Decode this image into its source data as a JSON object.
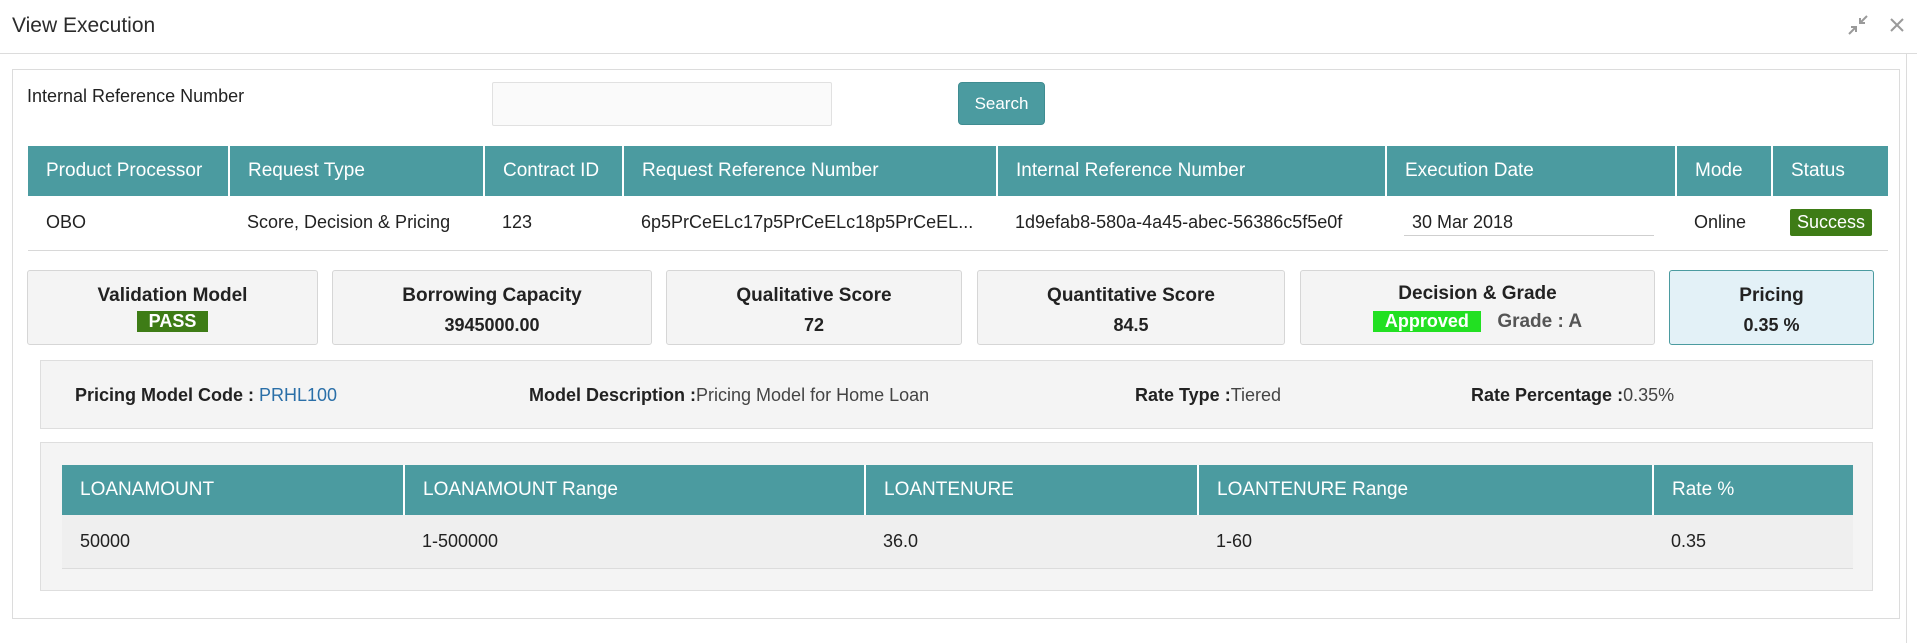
{
  "window": {
    "title": "View Execution",
    "minimize_icon": "collapse-arrows-icon",
    "close_icon": "close-icon"
  },
  "search": {
    "label": "Internal Reference Number",
    "value": "",
    "placeholder": "",
    "button_label": "Search"
  },
  "execution_table": {
    "headers": [
      "Product Processor",
      "Request Type",
      "Contract ID",
      "Request Reference Number",
      "Internal Reference Number",
      "Execution Date",
      "Mode",
      "Status"
    ],
    "row": {
      "product_processor": "OBO",
      "request_type": "Score, Decision & Pricing",
      "contract_id": "123",
      "request_reference_number": "6p5PrCeELc17p5PrCeELc18p5PrCeEL...",
      "internal_reference_number": "1d9efab8-580a-4a45-abec-56386c5f5e0f",
      "execution_date": "30 Mar 2018",
      "mode": "Online",
      "status": "Success"
    }
  },
  "cards": {
    "validation": {
      "title": "Validation Model",
      "value": "PASS"
    },
    "borrowing": {
      "title": "Borrowing Capacity",
      "value": "3945000.00"
    },
    "qualitative": {
      "title": "Qualitative Score",
      "value": "72"
    },
    "quantitative": {
      "title": "Quantitative Score",
      "value": "84.5"
    },
    "decision": {
      "title": "Decision & Grade",
      "decision": "Approved",
      "grade": "Grade : A"
    },
    "pricing": {
      "title": "Pricing",
      "value": "0.35 %"
    }
  },
  "pricing_info": {
    "model_code_label": "Pricing Model Code : ",
    "model_code_value": "PRHL100",
    "model_desc_label": "Model Description :",
    "model_desc_value": "Pricing Model for Home Loan",
    "rate_type_label": "Rate Type :",
    "rate_type_value": "Tiered",
    "rate_pct_label": "Rate Percentage :",
    "rate_pct_value": "0.35%"
  },
  "rate_table": {
    "headers": [
      "LOANAMOUNT",
      "LOANAMOUNT Range",
      "LOANTENURE",
      "LOANTENURE Range",
      "Rate %"
    ],
    "rows": [
      [
        "50000",
        "1-500000",
        "36.0",
        "1-60",
        "0.35"
      ]
    ]
  },
  "colors": {
    "header_teal": "#4b9ba0",
    "success_green": "#3e7c16",
    "approved_green": "#22e022",
    "link_blue": "#2a6fa8",
    "active_card_bg": "#e3f1f7"
  }
}
